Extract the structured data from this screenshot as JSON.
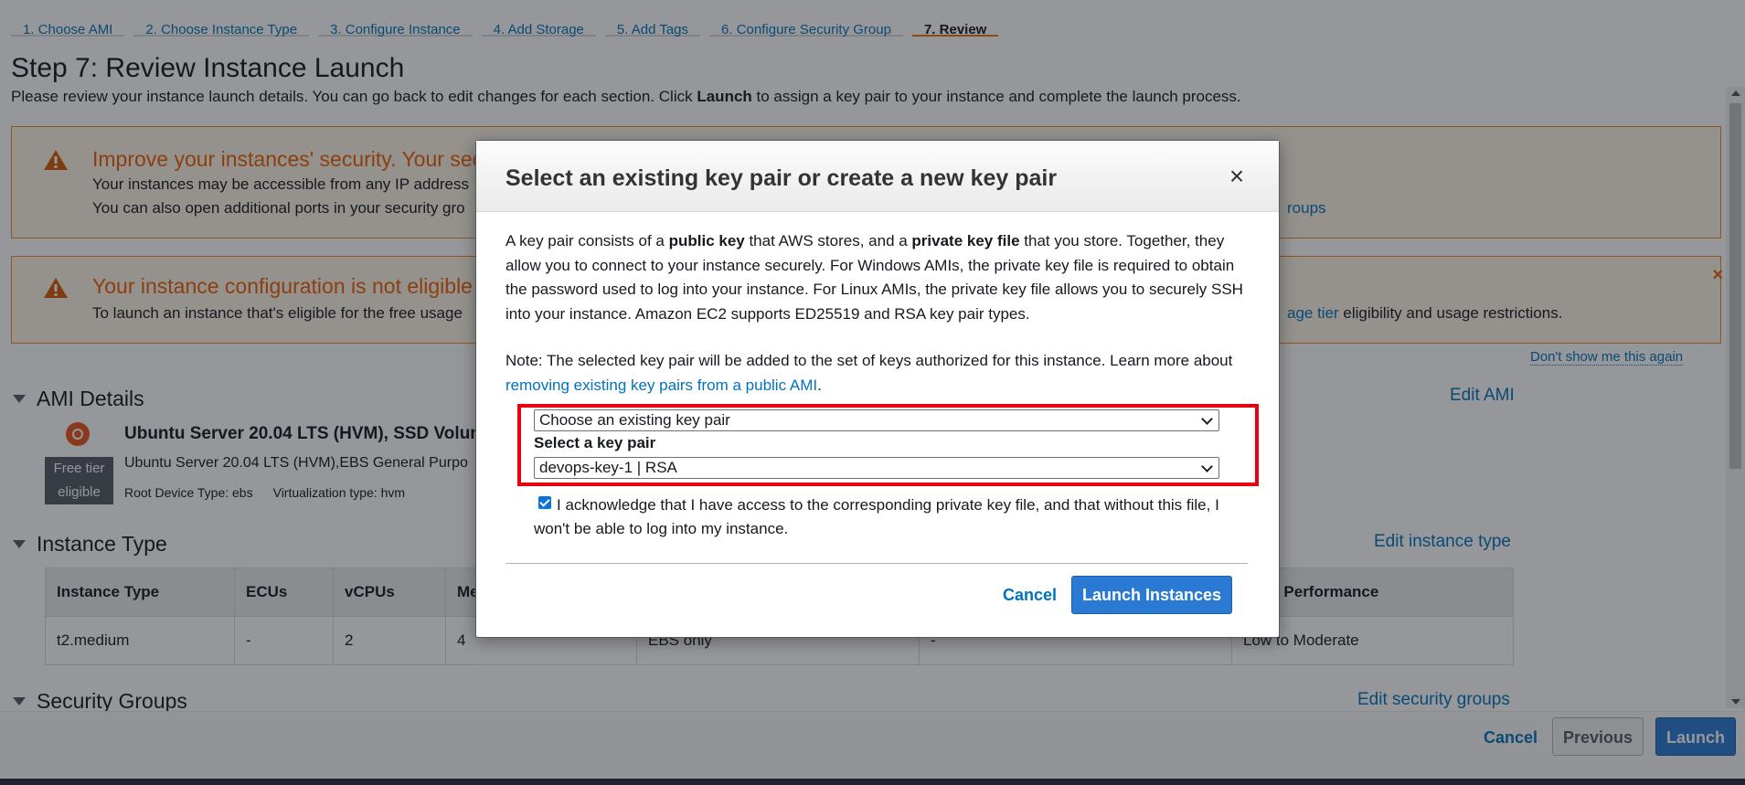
{
  "wizard": {
    "tabs": [
      "1. Choose AMI",
      "2. Choose Instance Type",
      "3. Configure Instance",
      "4. Add Storage",
      "5. Add Tags",
      "6. Configure Security Group",
      "7. Review"
    ],
    "active_tab": "7. Review"
  },
  "page": {
    "title": "Step 7: Review Instance Launch",
    "desc_before": "Please review your instance launch details. You can go back to edit changes for each section. Click ",
    "desc_bold": "Launch",
    "desc_after": " to assign a key pair to your instance and complete the launch process."
  },
  "alerts": {
    "security": {
      "heading": "Improve your instances' security. Your sec",
      "line1": "Your instances may be accessible from any IP address",
      "line2": "You can also open additional ports in your security gro",
      "link_tail": "roups"
    },
    "free_tier": {
      "heading": "Your instance configuration is not eligible f",
      "line1": "To launch an instance that's eligible for the free usage",
      "link_tail": "age tier",
      "line1_tail": " eligibility and usage restrictions.",
      "dismiss": "×",
      "dont_show": "Don't show me this again"
    }
  },
  "ami": {
    "section": "AMI Details",
    "edit": "Edit AMI",
    "badge_line1": "Free tier",
    "badge_line2": "eligible",
    "title": "Ubuntu Server 20.04 LTS (HVM), SSD Volum",
    "subtitle": "Ubuntu Server 20.04 LTS (HVM),EBS General Purpo",
    "root_device": "Root Device Type: ebs",
    "virt_type": "Virtualization type: hvm"
  },
  "instance_type": {
    "section": "Instance Type",
    "edit": "Edit instance type",
    "headers": [
      "Instance Type",
      "ECUs",
      "vCPUs",
      "Me",
      "",
      "",
      "work Performance"
    ],
    "row": [
      "t2.medium",
      "-",
      "2",
      "4",
      "EBS only",
      "-",
      "Low to Moderate"
    ]
  },
  "security_groups": {
    "section": "Security Groups",
    "edit": "Edit security groups"
  },
  "footer": {
    "cancel": "Cancel",
    "previous": "Previous",
    "launch": "Launch"
  },
  "modal": {
    "title": "Select an existing key pair or create a new key pair",
    "close": "×",
    "p1_a": "A key pair consists of a ",
    "p1_b": "public key",
    "p1_c": " that AWS stores, and a ",
    "p1_d": "private key file",
    "p1_e": " that you store. Together, they allow you to connect to your instance securely. For Windows AMIs, the private key file is required to obtain the password used to log into your instance. For Linux AMIs, the private key file allows you to securely SSH into your instance. Amazon EC2 supports ED25519 and RSA key pair types.",
    "note_a": "Note: The selected key pair will be added to the set of keys authorized for this instance. Learn more about ",
    "note_link": "removing existing key pairs from a public AMI",
    "note_b": ".",
    "mode_select": "Choose an existing key pair",
    "keypair_label": "Select a key pair",
    "keypair_select": "devops-key-1 | RSA",
    "ack": "I acknowledge that I have access to the corresponding private key file, and that without this file, I won't be able to log into my instance.",
    "ack_checked": true,
    "cancel": "Cancel",
    "launch": "Launch Instances"
  }
}
